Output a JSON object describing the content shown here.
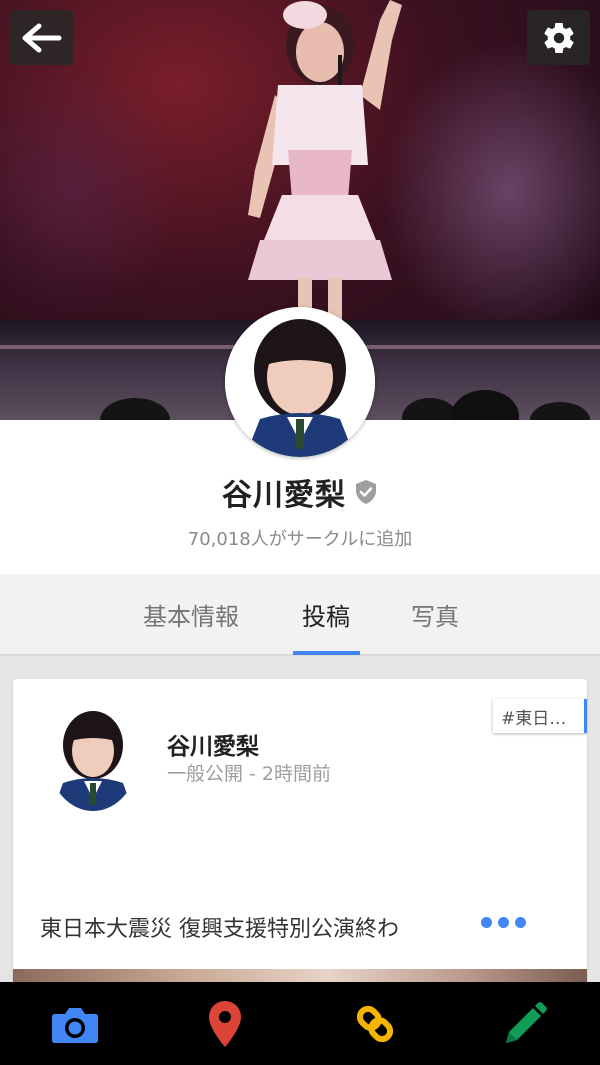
{
  "cover": {
    "back_icon": "arrow-left-icon",
    "settings_icon": "gear-icon"
  },
  "profile": {
    "name": "谷川愛梨",
    "verified_icon": "verified-shield-icon",
    "followers": "70,018人がサークルに追加"
  },
  "tabs": [
    {
      "label": "基本情報"
    },
    {
      "label": "投稿",
      "active": true
    },
    {
      "label": "写真"
    }
  ],
  "post": {
    "author": "谷川愛梨",
    "meta": "一般公開 - 2時間前",
    "hashtag": "#東日…",
    "text": "東日本大震災 復興支援特別公演終わ",
    "more_icon": "more-dots-icon"
  },
  "bottom_bar": {
    "items": [
      {
        "icon": "camera-icon",
        "color": "#4285f4"
      },
      {
        "icon": "location-pin-icon",
        "color": "#db4437"
      },
      {
        "icon": "link-icon",
        "color": "#f4b400"
      },
      {
        "icon": "pencil-icon",
        "color": "#0f9d58"
      }
    ]
  },
  "colors": {
    "accent": "#4285f4",
    "tab_underline": "#4285f4"
  }
}
